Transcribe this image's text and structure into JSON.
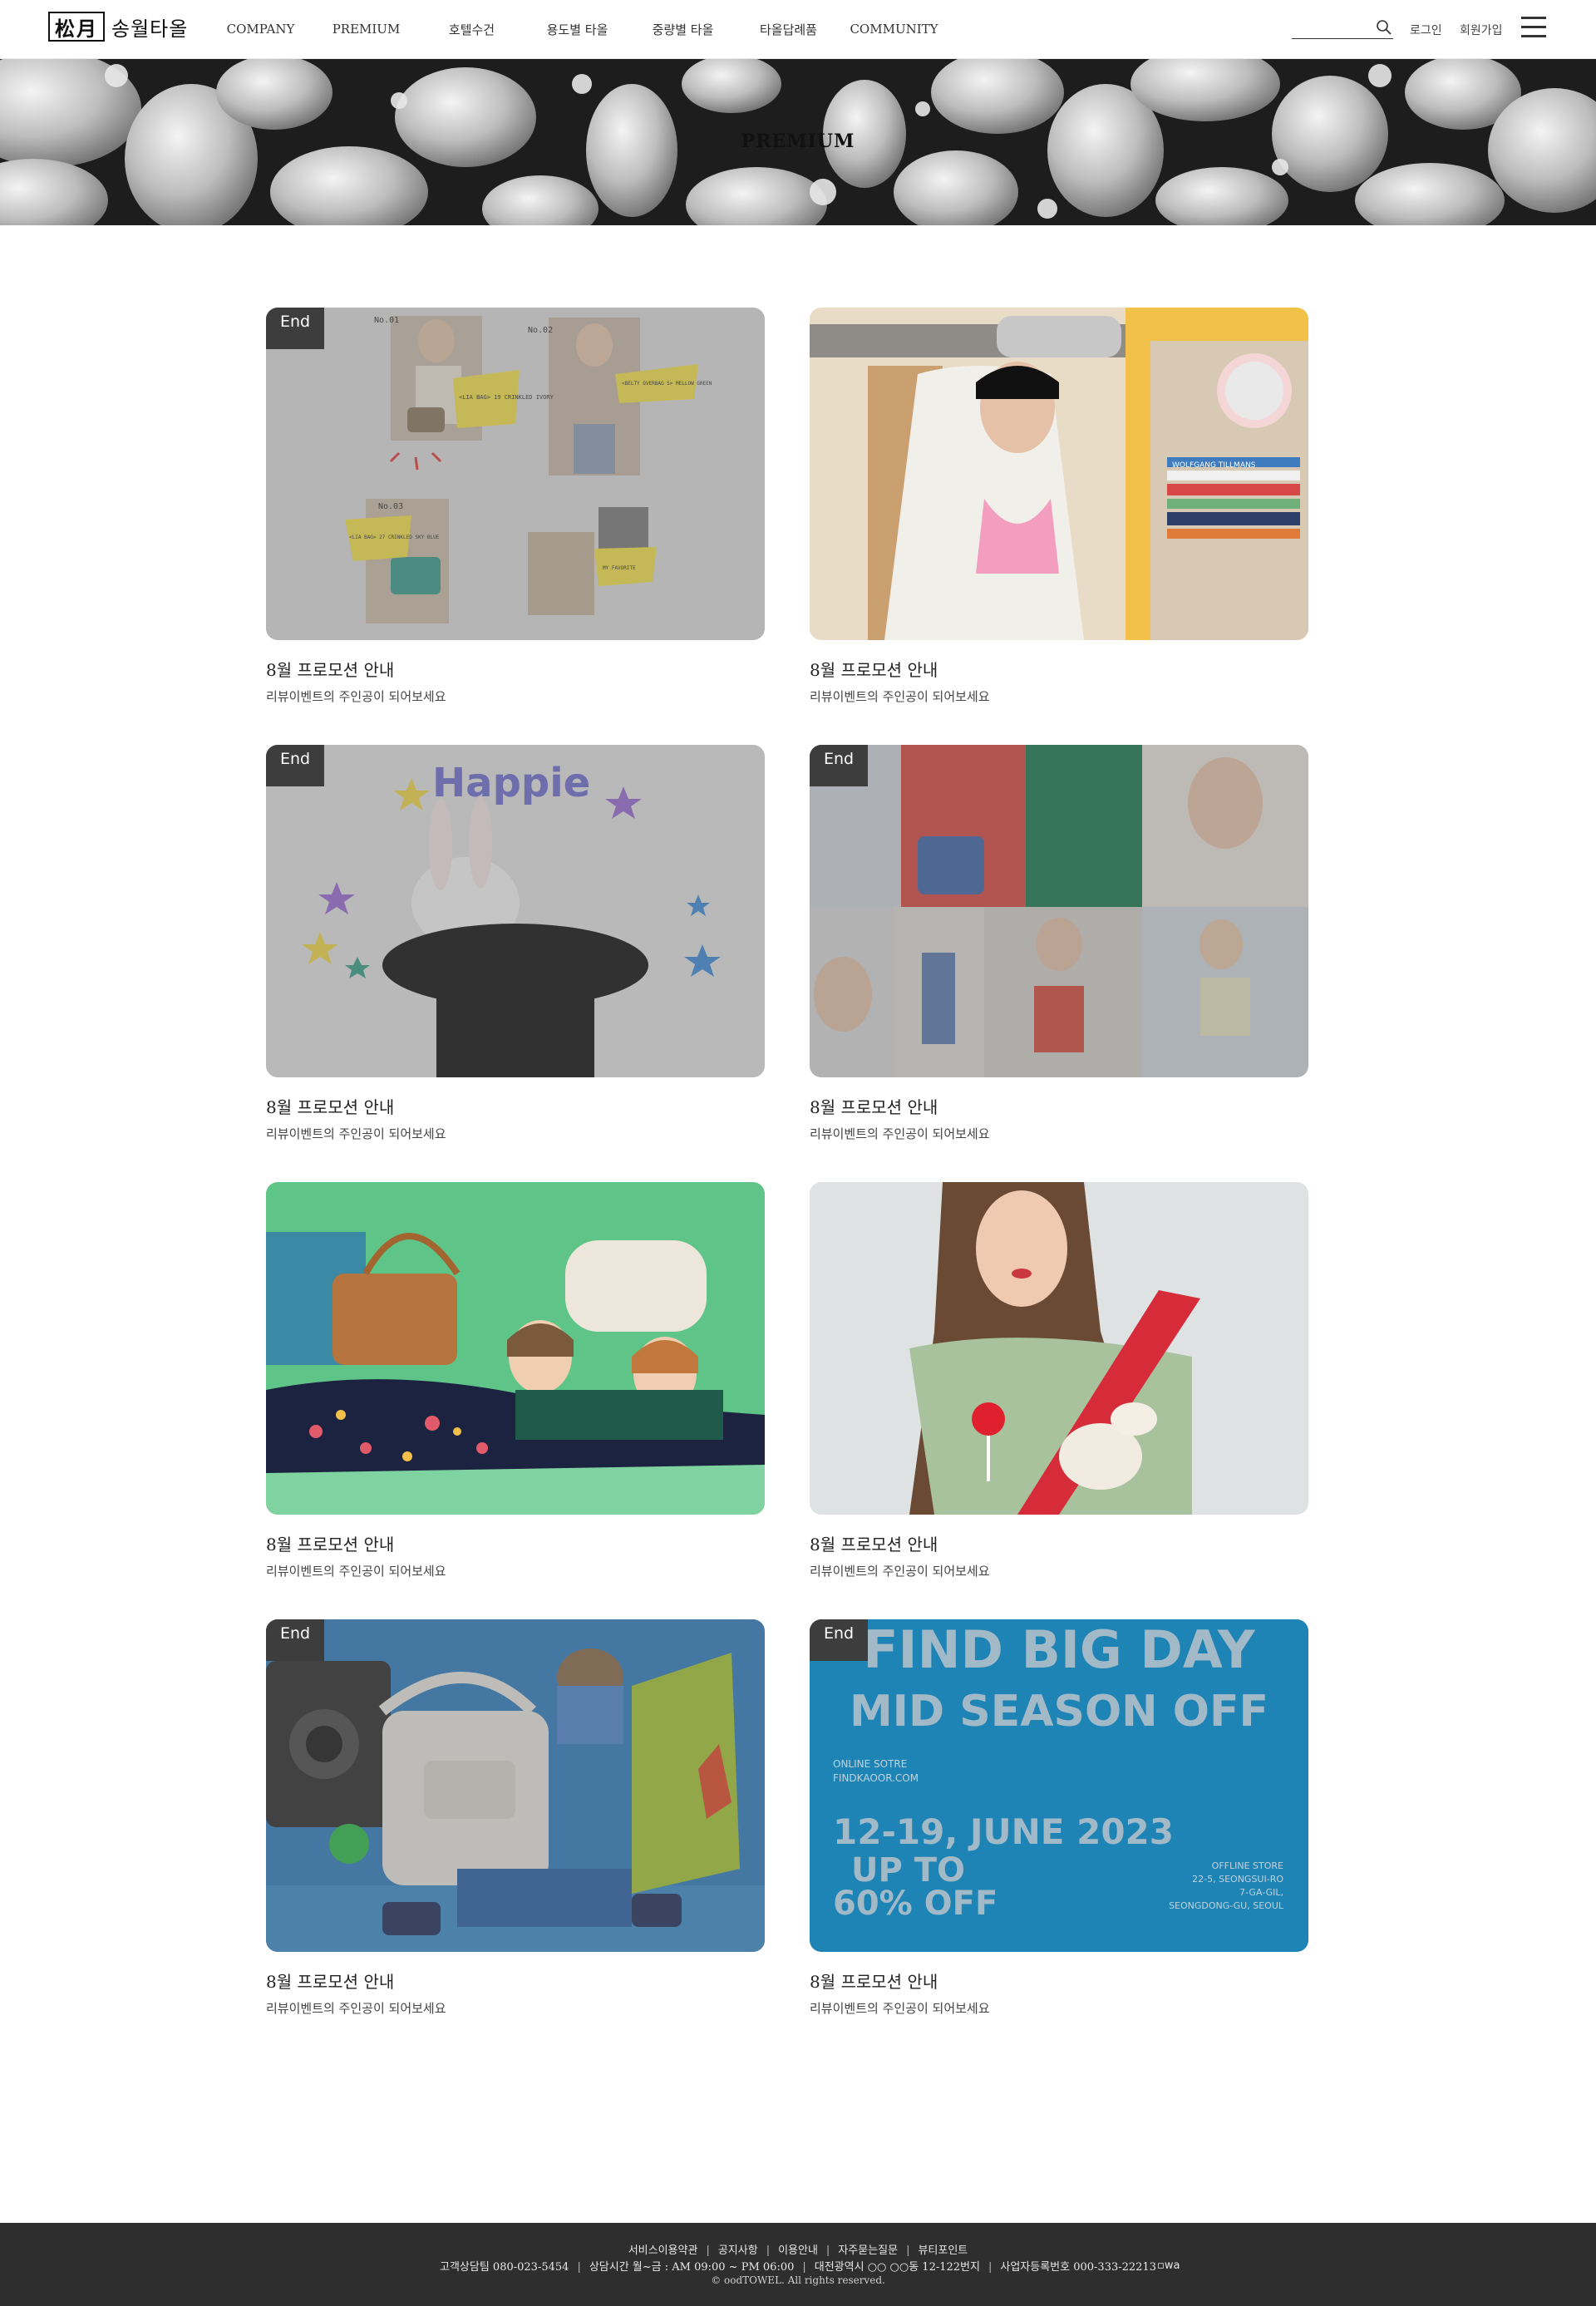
{
  "header": {
    "logo_seal": "松月",
    "logo_text": "송월타올",
    "nav": [
      "COMPANY",
      "PREMIUM",
      "호텔수건",
      "용도별 타올",
      "중량별 타올",
      "타올답례품",
      "COMMUNITY"
    ],
    "search_placeholder": "",
    "login": "로그인",
    "signup": "회원가입"
  },
  "banner": {
    "title": "PREMIUM"
  },
  "cards": [
    {
      "title": "8월 프로모션 안내",
      "desc": "리뷰이벤트의 주인공이 되어보세요",
      "badge": "End"
    },
    {
      "title": "8월 프로모션 안내",
      "desc": "리뷰이벤트의 주인공이 되어보세요",
      "badge": ""
    },
    {
      "title": "8월 프로모션 안내",
      "desc": "리뷰이벤트의 주인공이 되어보세요",
      "badge": "End"
    },
    {
      "title": "8월 프로모션 안내",
      "desc": "리뷰이벤트의 주인공이 되어보세요",
      "badge": "End"
    },
    {
      "title": "8월 프로모션 안내",
      "desc": "리뷰이벤트의 주인공이 되어보세요",
      "badge": ""
    },
    {
      "title": "8월 프로모션 안내",
      "desc": "리뷰이벤트의 주인공이 되어보세요",
      "badge": ""
    },
    {
      "title": "8월 프로모션 안내",
      "desc": "리뷰이벤트의 주인공이 되어보세요",
      "badge": "End"
    },
    {
      "title": "8월 프로모션 안내",
      "desc": "리뷰이벤트의 주인공이 되어보세요",
      "badge": "End"
    }
  ],
  "card_art": {
    "collage_labels": [
      "No.01",
      "No.02",
      "No.03"
    ],
    "collage_notes": [
      "<LIA BAG> 19 CRINKLED IVORY",
      "<BELTY OVERBAG S> MELLOW GREEN",
      "<LIA BAG> 27 CRINKLED SKY BLUE",
      "MY FAVORITE"
    ],
    "happie_text": "Happie",
    "sale_line1": "FIND BIG DAY",
    "sale_line2": "MID SEASON OFF",
    "sale_online": "ONLINE SOTRE",
    "sale_site": "FINDKAOOR.COM",
    "sale_dates": "12-19, JUNE 2023",
    "sale_offer1": "UP TO",
    "sale_offer2": "60% OFF",
    "sale_offline": "OFFLINE STORE",
    "sale_addr1": "22-5, SEONGSUI-RO",
    "sale_addr2": "7-GA-GIL,",
    "sale_addr3": "SEONGDONG-GU, SEOUL",
    "book_label": "WOLFGANG TILLMANS"
  },
  "footer": {
    "links": [
      "서비스이용약관",
      "공지사항",
      "이용안내",
      "자주묻는질문",
      "뷰티포인트"
    ],
    "phone": "고객상담팀 080-023-5454",
    "hours": "상담시간 월~금 : AM 09:00 ~ PM 06:00",
    "address": "대전광역시 ○○ ○○동 12-122번지",
    "bizno": "사업자등록번호 000-333-22213",
    "badge_alt": "wa",
    "copyright": "© oodTOWEL. All rights reserved."
  },
  "colors": {
    "footer_bg": "#2e2e2e",
    "badge_bg": "#3d3d3d",
    "sale_blue": "#1888bf",
    "green_bg": "#5fc488"
  }
}
